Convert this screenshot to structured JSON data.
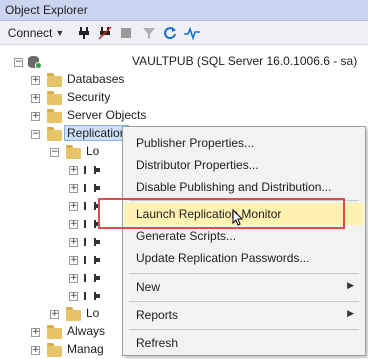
{
  "window": {
    "title": "Object Explorer"
  },
  "toolbar": {
    "connect_label": "Connect",
    "icons": [
      "connect-icon",
      "plug-icon",
      "disconnect-icon",
      "stop-icon",
      "filter-icon",
      "refresh-icon",
      "activity-monitor-icon"
    ]
  },
  "tree": {
    "server": {
      "label": "VAULTPUB (SQL Server 16.0.1006.6 - sa)",
      "icon": "database-server-icon"
    },
    "nodes": [
      {
        "label": "Databases"
      },
      {
        "label": "Security"
      },
      {
        "label": "Server Objects"
      },
      {
        "label": "Replication"
      }
    ],
    "replication_children": [
      {
        "label": "Lo"
      },
      {
        "label": "Lo"
      }
    ],
    "bottom_nodes": [
      {
        "label": "Always"
      },
      {
        "label": "Manag"
      }
    ]
  },
  "context_menu": {
    "items": [
      {
        "label": "Publisher Properties..."
      },
      {
        "label": "Distributor Properties..."
      },
      {
        "label": "Disable Publishing and Distribution..."
      },
      {
        "label": "Launch Replication Monitor",
        "highlighted": true
      },
      {
        "label": "Generate Scripts..."
      },
      {
        "label": "Update Replication Passwords..."
      },
      {
        "label": "New",
        "submenu": true
      },
      {
        "label": "Reports",
        "submenu": true
      },
      {
        "label": "Refresh"
      }
    ]
  },
  "colors": {
    "title_bar": "#ccd5f0",
    "highlight": "#fff2b3",
    "annotation_box": "#e14b4b",
    "folder": "#e8c468"
  }
}
